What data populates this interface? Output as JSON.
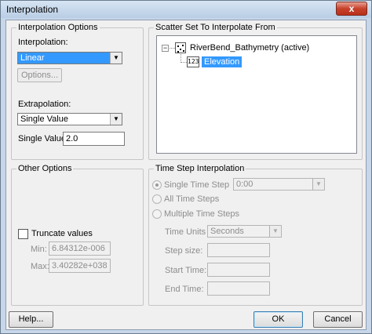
{
  "window": {
    "title": "Interpolation",
    "close_glyph": "x"
  },
  "interp_options": {
    "legend": "Interpolation Options",
    "interpolation_label": "Interpolation:",
    "interpolation_value": "Linear",
    "options_button": "Options...",
    "extrapolation_label": "Extrapolation:",
    "extrapolation_value": "Single Value",
    "single_value_label": "Single Value:",
    "single_value": "2.0"
  },
  "scatter_set": {
    "legend": "Scatter Set To Interpolate From",
    "expander_glyph": "−",
    "root_label": "RiverBend_Bathymetry (active)",
    "child_icon_text": "123",
    "child_label": "Elevation"
  },
  "other_options": {
    "legend": "Other Options",
    "truncate_label": "Truncate values",
    "min_label": "Min:",
    "min_value": "6.84312e-006",
    "max_label": "Max:",
    "max_value": "3.40282e+038"
  },
  "time_step": {
    "legend": "Time Step Interpolation",
    "single_time_step_label": "Single Time Step",
    "single_time_step_value": "0:00",
    "all_time_steps_label": "All Time Steps",
    "multiple_time_steps_label": "Multiple Time Steps",
    "time_units_label": "Time Units",
    "time_units_value": "Seconds",
    "step_size_label": "Step size:",
    "start_time_label": "Start Time:",
    "end_time_label": "End Time:"
  },
  "footer": {
    "help_button": "Help...",
    "ok_button": "OK",
    "cancel_button": "Cancel"
  },
  "icons": {
    "dropdown": "dropdown-arrow-icon",
    "scatter": "scatter-set-icon",
    "dataset": "dataset-123-icon"
  },
  "colors": {
    "selection": "#3399ff",
    "frame": "#c7d7e9",
    "close_button": "#c7412b"
  }
}
